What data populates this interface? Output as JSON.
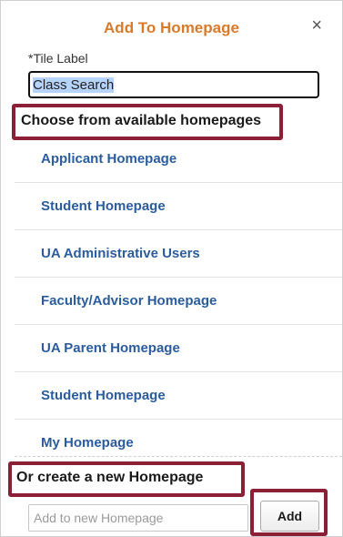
{
  "dialog": {
    "title": "Add To Homepage",
    "close_symbol": "×"
  },
  "tile": {
    "label": "*Tile Label",
    "value": "Class Search"
  },
  "available": {
    "heading": "Choose from available homepages",
    "items": [
      {
        "label": "Applicant Homepage"
      },
      {
        "label": "Student Homepage"
      },
      {
        "label": "UA Administrative Users"
      },
      {
        "label": "Faculty/Advisor Homepage"
      },
      {
        "label": "UA Parent Homepage"
      },
      {
        "label": "Student Homepage"
      },
      {
        "label": "My Homepage"
      }
    ]
  },
  "create": {
    "heading": "Or create a new Homepage",
    "placeholder": "Add to new Homepage",
    "value": "",
    "add_label": "Add"
  },
  "colors": {
    "title": "#d97a2b",
    "link": "#2a5c9e",
    "highlight": "#8b1f35"
  },
  "icons": {
    "close": "close-icon"
  }
}
